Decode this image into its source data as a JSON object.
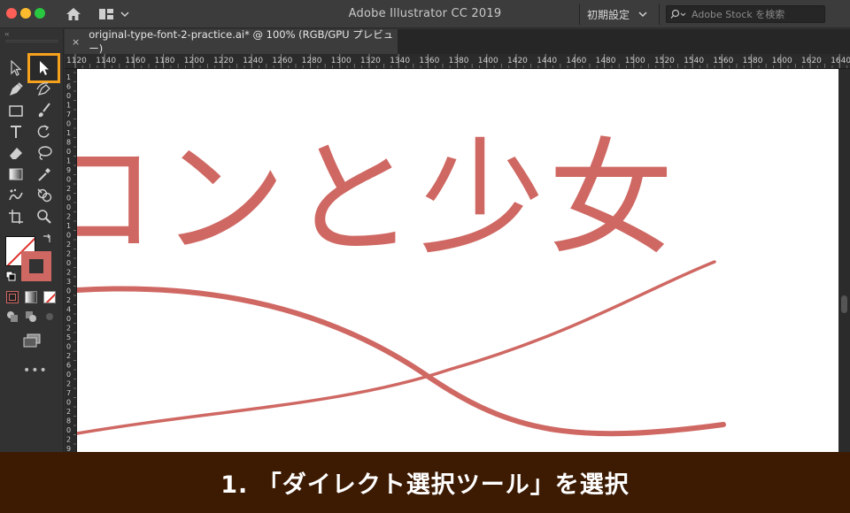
{
  "window": {
    "title": "Adobe Illustrator CC 2019"
  },
  "header": {
    "workspace_label": "初期設定",
    "stock_placeholder": "Adobe Stock を検索"
  },
  "document": {
    "tab_title": "original-type-font-2-practice.ai* @ 100% (RGB/GPU プレビュー)",
    "close_glyph": "×",
    "artwork_text": "ロンと少女"
  },
  "ruler": {
    "top_labels": [
      "1120",
      "1140",
      "1160",
      "1180",
      "1200",
      "1220",
      "1240",
      "1260",
      "1280",
      "1300",
      "1320",
      "1340",
      "1360",
      "1380",
      "1400",
      "1420",
      "1440",
      "1460",
      "1480",
      "1500",
      "1520",
      "1540",
      "1560",
      "1580",
      "1600",
      "1620",
      "1640"
    ],
    "left_labels": [
      "1",
      "6",
      "0",
      "1",
      "7",
      "0",
      "1",
      "8",
      "0",
      "1",
      "9",
      "0",
      "2",
      "0",
      "0",
      "2",
      "1",
      "0",
      "2",
      "2",
      "0",
      "2",
      "3",
      "0",
      "2",
      "4",
      "0",
      "2",
      "5",
      "0",
      "2",
      "6",
      "0",
      "2",
      "7",
      "0",
      "2",
      "8",
      "0",
      "2",
      "9",
      "0"
    ]
  },
  "toolbar": {
    "collapse_glyph": "‹‹",
    "more_glyph": "•••",
    "selected_tool": "direct-selection",
    "tools": [
      "selection-tool",
      "direct-selection-tool",
      "pen-tool",
      "curvature-tool",
      "rectangle-tool",
      "paintbrush-tool",
      "type-tool",
      "rotate-tool",
      "eraser-tool",
      "lasso-tool",
      "gradient-tool",
      "eyedropper-tool",
      "symbol-sprayer-tool",
      "shape-builder-tool",
      "artboard-tool",
      "zoom-tool"
    ]
  },
  "colors": {
    "accent_highlight": "#f6a21d",
    "artwork": "#cf6863",
    "caption_background": "#3d1b03"
  },
  "caption": {
    "text": "1. 「ダイレクト選択ツール」を選択"
  }
}
